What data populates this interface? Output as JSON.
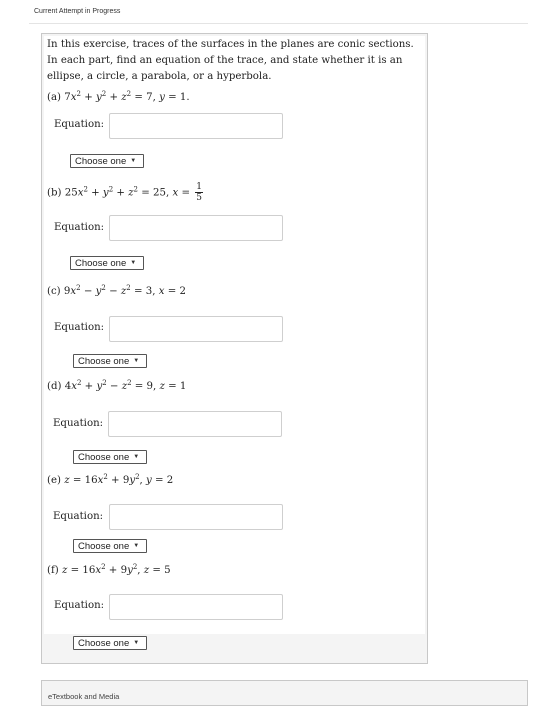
{
  "header": {
    "title": "Current Attempt in Progress"
  },
  "intro": [
    "In this exercise, traces of the surfaces in the planes are conic sections.",
    "In each part, find an equation of the trace, and state whether it is an",
    "ellipse, a circle, a parabola, or a hyperbola."
  ],
  "parts": [
    {
      "label": "(a)",
      "equation_label": "Equation:",
      "answer": "",
      "choice": "Choose one"
    },
    {
      "label": "(b)",
      "equation_label": "Equation:",
      "answer": "",
      "choice": "Choose one",
      "frac_num": "1",
      "frac_den": "5"
    },
    {
      "label": "(c)",
      "equation_label": "Equation:",
      "answer": "",
      "choice": "Choose one"
    },
    {
      "label": "(d)",
      "equation_label": "Equation:",
      "answer": "",
      "choice": "Choose one"
    },
    {
      "label": "(e)",
      "equation_label": "Equation:",
      "answer": "",
      "choice": "Choose one"
    },
    {
      "label": "(f)",
      "equation_label": "Equation:",
      "answer": "",
      "choice": "Choose one"
    }
  ],
  "footer": {
    "label": "eTextbook and Media"
  },
  "icons": {
    "select_caret": "caret-down-icon"
  }
}
